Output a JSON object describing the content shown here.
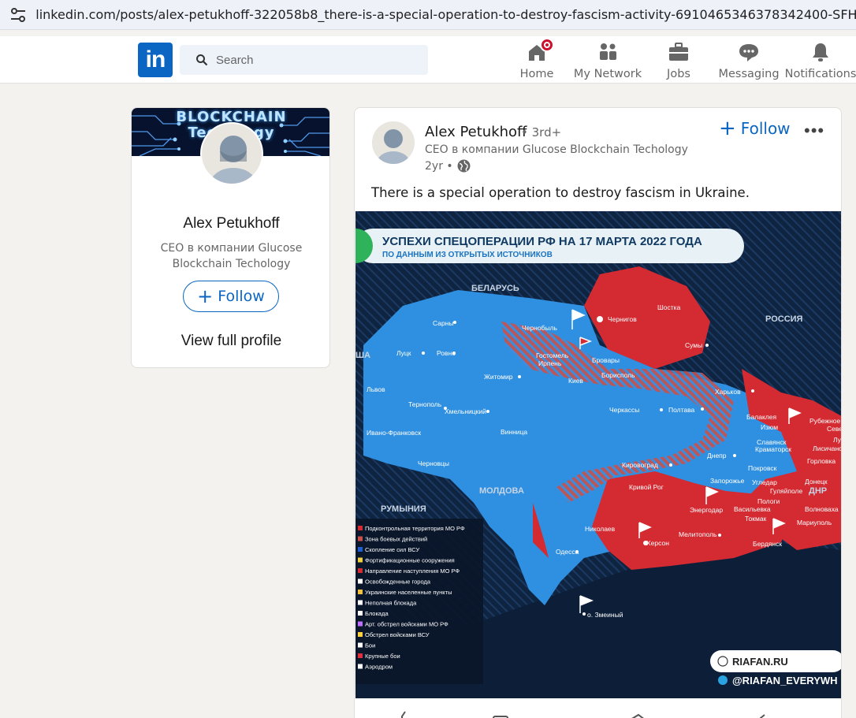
{
  "browser": {
    "url": "linkedin.com/posts/alex-petukhoff-322058b8_there-is-a-special-operation-to-destroy-fascism-activity-6910465346378342400-SFHR/?u"
  },
  "nav": {
    "logo": "in",
    "search_placeholder": "Search",
    "items": [
      {
        "label": "Home",
        "icon": "home-icon"
      },
      {
        "label": "My Network",
        "icon": "network-icon"
      },
      {
        "label": "Jobs",
        "icon": "briefcase-icon"
      },
      {
        "label": "Messaging",
        "icon": "message-icon"
      },
      {
        "label": "Notifications",
        "icon": "bell-icon"
      }
    ],
    "accent": "#0a66c2"
  },
  "profile": {
    "banner_text_1": "BLOCKCHAIN",
    "banner_text_2": "Techology",
    "name": "Alex Petukhoff",
    "headline": "CEO в компании Glucose Blockchain Techology",
    "follow": "Follow",
    "view_full": "View full profile"
  },
  "post": {
    "author": "Alex Petukhoff",
    "degree": "• 3rd+",
    "subtitle": "CEO в компании Glucose Blockchain Techology",
    "time": "2yr •",
    "follow": "Follow",
    "text": "There is a special operation to destroy fascism in Ukraine.",
    "map": {
      "title": "УСПЕХИ СПЕЦОПЕРАЦИИ РФ НА 17 МАРТА 2022 ГОДА",
      "subtitle": "ПО ДАННЫМ ИЗ ОТКРЫТЫХ ИСТОЧНИКОВ",
      "countries": {
        "belarus": "БЕЛАРУСЬ",
        "russia": "РОССИЯ",
        "romania": "РУМЫНИЯ",
        "moldova": "МОЛДОВА",
        "dnr": "ДНР",
        "sha": "ША"
      },
      "cities": {
        "sarny": "Сарны",
        "lutsk": "Луцк",
        "rovno": "Ровно",
        "lvov": "Львов",
        "ternopol": "Тернополь",
        "khmelnitsky": "Хмельницкий",
        "ivanofrankovsk": "Ивано-Франковск",
        "chernovtsy": "Черновцы",
        "zhitomir": "Житомир",
        "vinnitsa": "Винница",
        "chernobyl": "Чернобыль",
        "gostomel": "Гостомель",
        "irpen": "Ирпень",
        "kiev": "Киев",
        "brovary": "Бровары",
        "borispol": "Борисполь",
        "chernigov": "Чернигов",
        "shostka": "Шостка",
        "sumy": "Сумы",
        "kharkov": "Харьков",
        "cherkassy": "Черкассы",
        "poltava": "Полтава",
        "balakleya": "Балаклея",
        "izyum": "Изюм",
        "slavyansk": "Славянск",
        "kramatorsk": "Краматорск",
        "rubezhnoe": "Рубежное",
        "sever": "Севе",
        "lisichansk": "Лисичанск",
        "lu": "Лу",
        "gorlovka": "Горловка",
        "pokrovsk": "Покровск",
        "ugledar": "Угледар",
        "donetsk": "Донецк",
        "dnepr": "Днепр",
        "kirovograd": "Кировоград",
        "zaporozhe": "Запорожье",
        "krivoyrog": "Кривой Рог",
        "energodar": "Энергодар",
        "vasilevka": "Васильевка",
        "gulyaipole": "Гуляйполе",
        "pologi": "Пологи",
        "tokmak": "Токмак",
        "volnovakha": "Волноваха",
        "mariupol": "Мариуполь",
        "nikolaev": "Николаев",
        "kherson": "Херсон",
        "melitopol": "Мелитополь",
        "berdyansk": "Бердянск",
        "odessa": "Одесса",
        "zmeiny": "о. Змеиный"
      },
      "legend": [
        "Подконтрольная территория МО РФ",
        "Зона боевых действий",
        "Скопление сил ВСУ",
        "Фортификационные сооружения",
        "Направление наступления МО РФ",
        "Освобожденные города",
        "Украинские населенные пункты",
        "Неполная блокада",
        "Блокада",
        "Арт. обстрел войсками МО РФ",
        "Обстрел войсками ВСУ",
        "Бои",
        "Крупные бои",
        "Аэродром"
      ],
      "source": "RIAFAN.RU",
      "telegram": "@RIAFAN_EVERYWH",
      "colors": {
        "sea": "#0f2440",
        "ukraine": "#2f8fe0",
        "russia_control": "#d42a32",
        "combat": "#c8514a"
      }
    }
  }
}
